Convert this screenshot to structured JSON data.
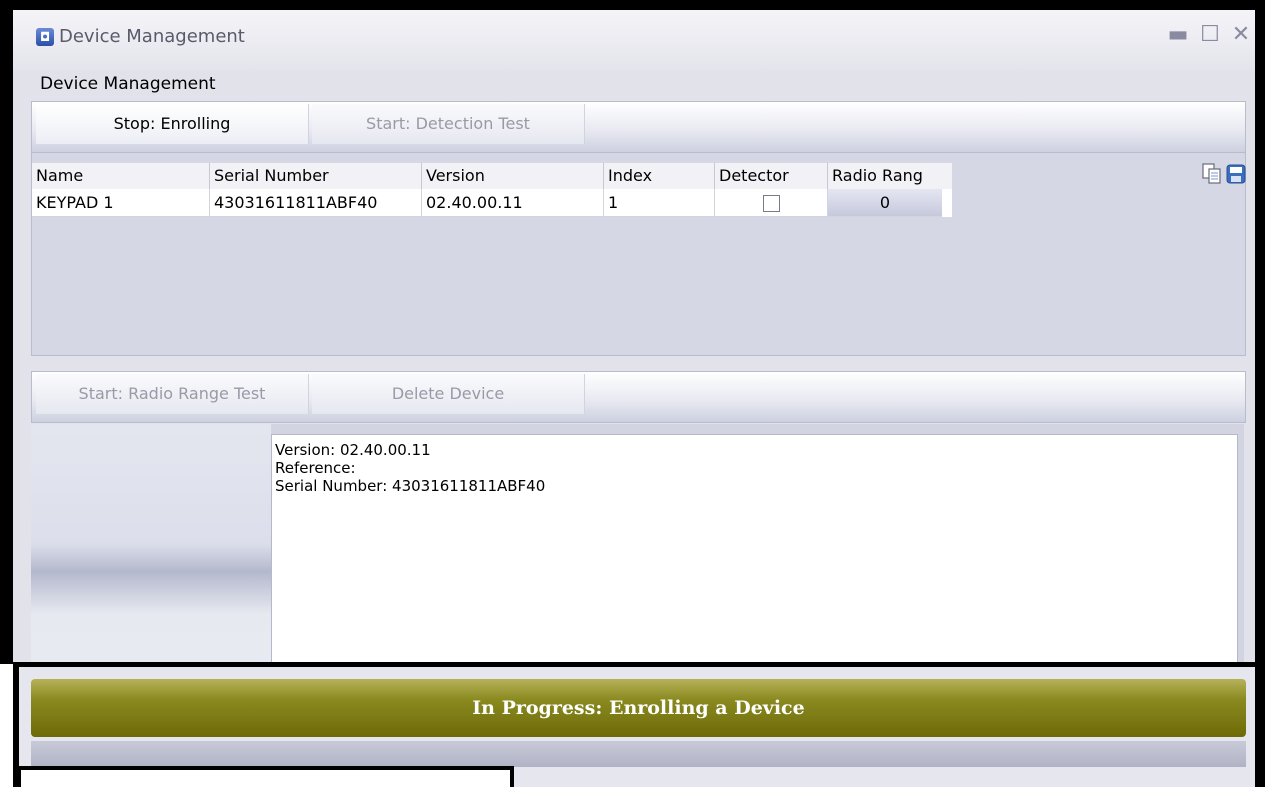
{
  "window": {
    "title": "Device Management",
    "controls": {
      "minimize": "▬",
      "maximize": "☐",
      "close": "✕"
    }
  },
  "section_label": "Device Management",
  "toolbar_top": {
    "stop_enrolling": "Stop: Enrolling",
    "start_detection_test": "Start: Detection Test"
  },
  "grid": {
    "columns": [
      "Name",
      "Serial Number",
      "Version",
      "Index",
      "Detector",
      "Radio Rang"
    ],
    "rows": [
      {
        "name": "KEYPAD 1",
        "serial": "43031611811ABF40",
        "version": "02.40.00.11",
        "index": "1",
        "detector_checked": false,
        "radio_range": "0"
      }
    ],
    "icons": [
      "copy-icon",
      "save-icon"
    ]
  },
  "toolbar_bottom": {
    "start_radio_range_test": "Start: Radio Range Test",
    "delete_device": "Delete Device"
  },
  "details": {
    "version": "Version: 02.40.00.11",
    "reference": "Reference:",
    "serial": "Serial Number: 43031611811ABF40"
  },
  "progress": {
    "text": "In Progress: Enrolling a Device",
    "bar_color": "#7c7a14"
  }
}
